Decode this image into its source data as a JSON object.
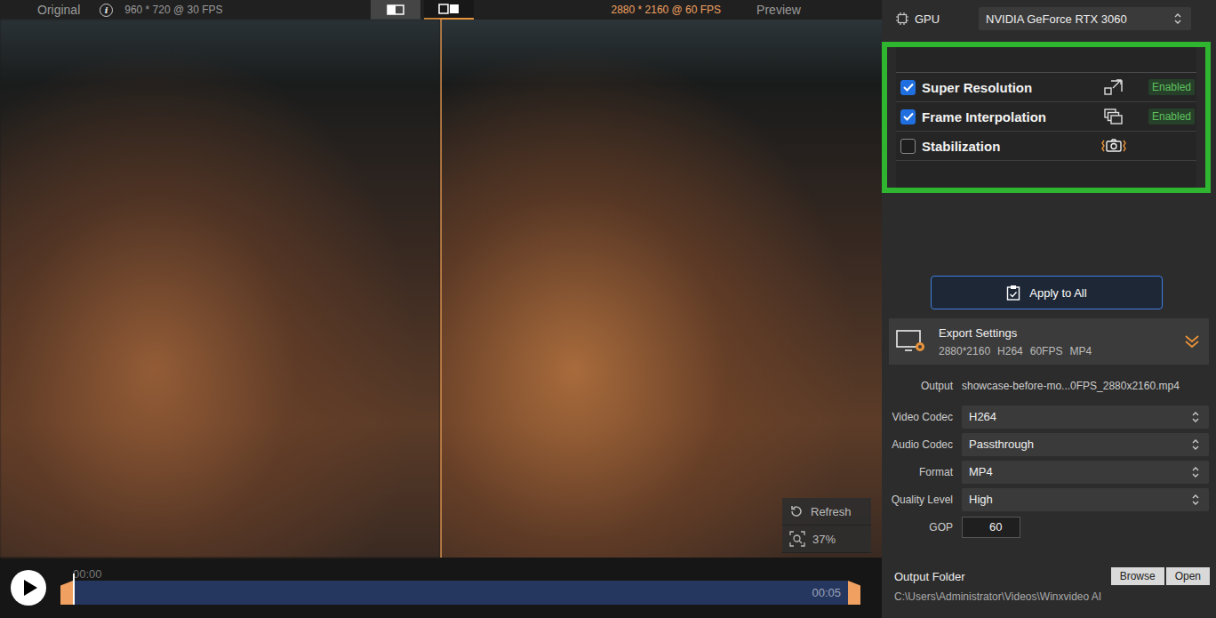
{
  "viewer_header": {
    "original_label": "Original",
    "info_icon": "i",
    "original_spec": "960 * 720 @ 30 FPS",
    "view_modes": [
      {
        "selected": false
      },
      {
        "selected": true
      }
    ],
    "preview_spec": "2880 * 2160 @ 60 FPS",
    "preview_label": "Preview"
  },
  "preview_tools": {
    "refresh": "Refresh",
    "zoom": "37%"
  },
  "timeline": {
    "start": "00:00",
    "end": "00:05",
    "level": 0
  },
  "gpu": {
    "label": "GPU",
    "value": "NVIDIA GeForce RTX 3060"
  },
  "features": [
    {
      "name": "Super Resolution",
      "checked": true,
      "badge": "Enabled"
    },
    {
      "name": "Frame Interpolation",
      "checked": true,
      "badge": "Enabled"
    },
    {
      "name": "Stabilization",
      "checked": false
    }
  ],
  "apply_button": "Apply to All",
  "export": {
    "title": "Export Settings",
    "summary": [
      "2880*2160",
      "H264",
      "60FPS",
      "MP4"
    ]
  },
  "output": {
    "label": "Output",
    "value": "showcase-before-mo...0FPS_2880x2160.mp4"
  },
  "settings": [
    {
      "label": "Video Codec",
      "value": "H264",
      "kind": "select"
    },
    {
      "label": "Audio Codec",
      "value": "Passthrough",
      "kind": "select"
    },
    {
      "label": "Format",
      "value": "MP4",
      "kind": "select"
    },
    {
      "label": "Quality Level",
      "value": "High",
      "kind": "select"
    },
    {
      "label": "GOP",
      "value": "60",
      "kind": "input"
    }
  ],
  "output_folder": {
    "label": "Output Folder",
    "buttons": [
      "Browse",
      "Open"
    ],
    "path": "C:\\Users\\Administrator\\Videos\\Winxvideo AI"
  }
}
